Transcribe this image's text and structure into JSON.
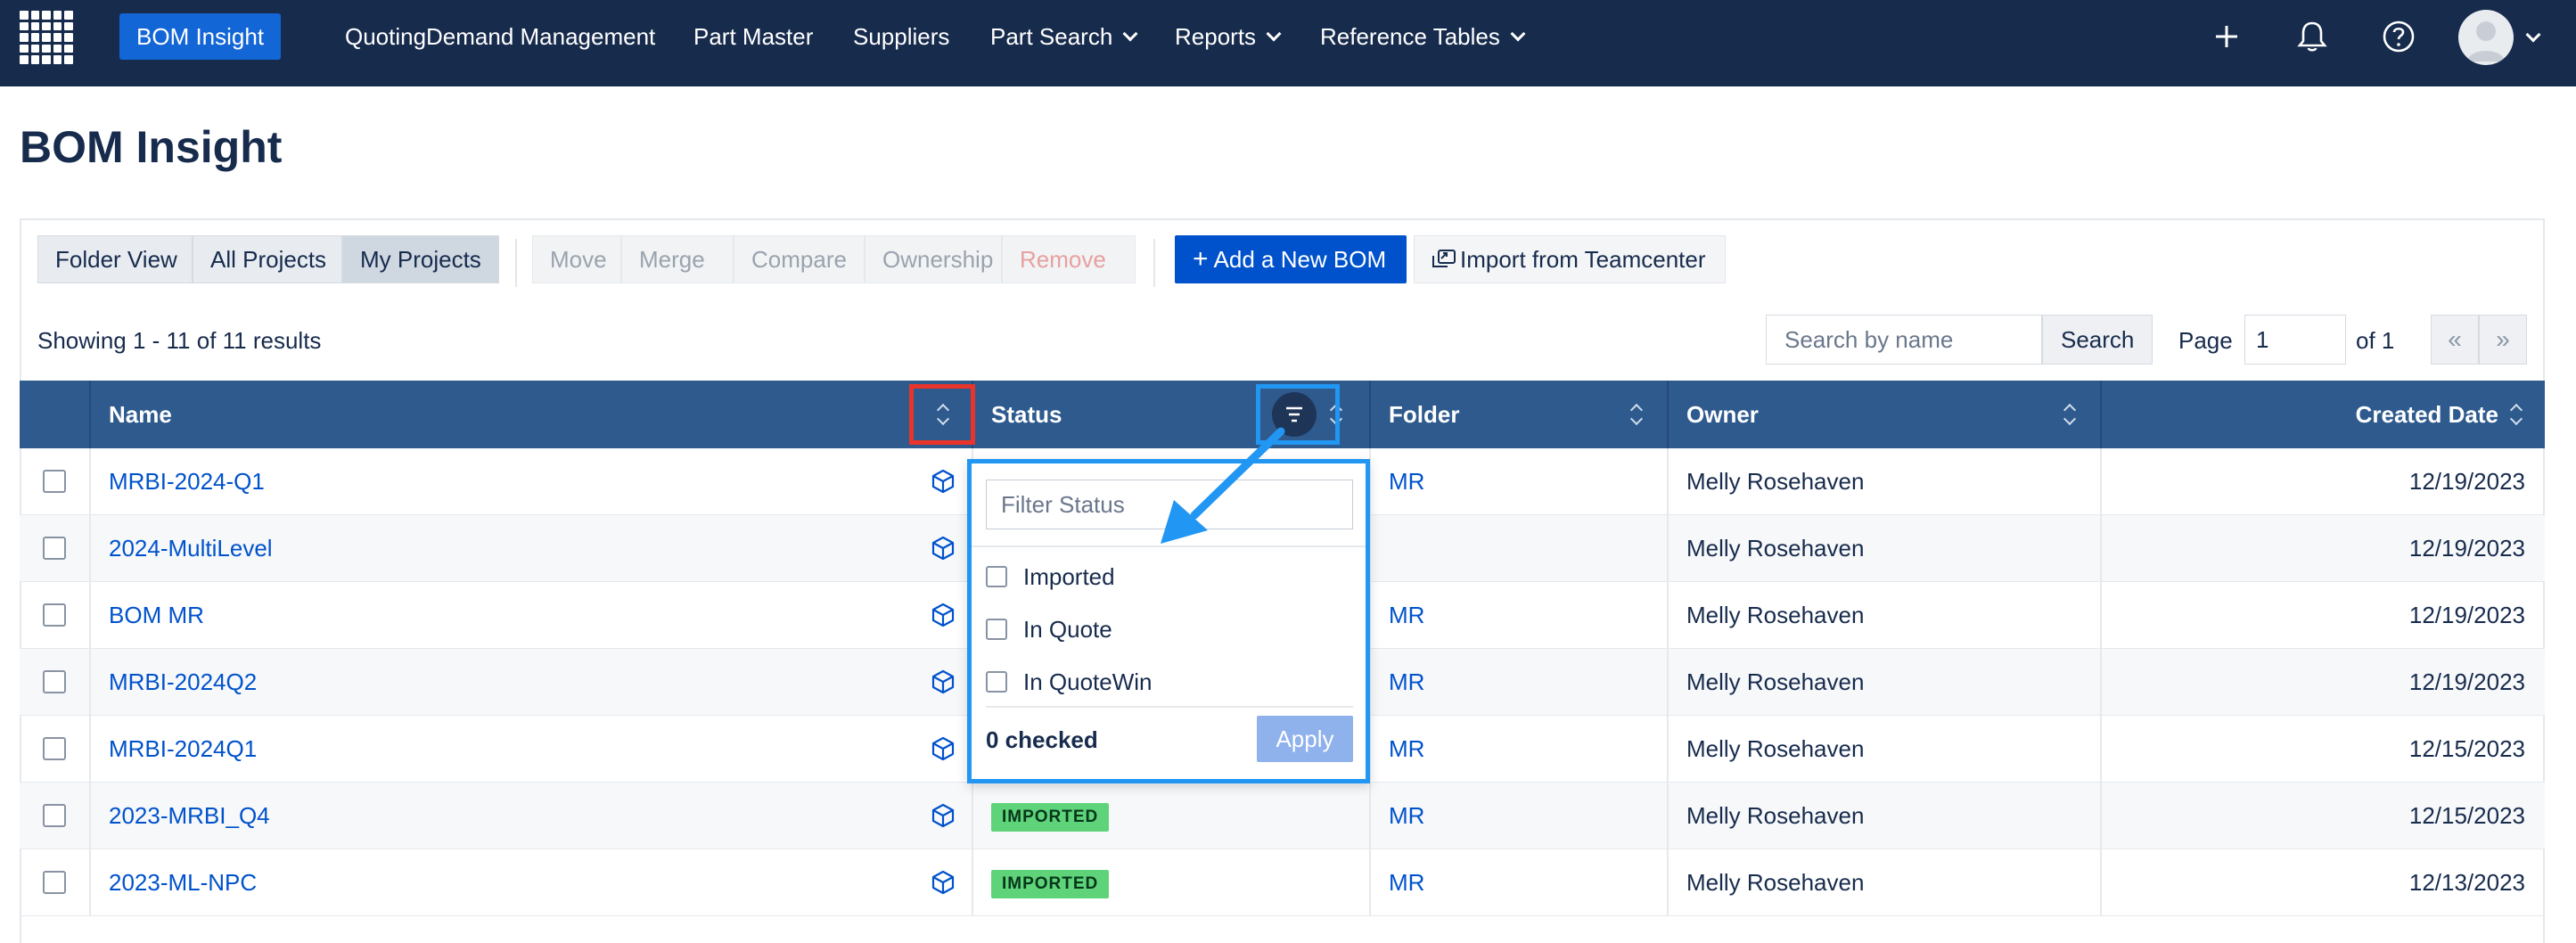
{
  "nav": {
    "items": [
      {
        "label": "BOM Insight",
        "active": true
      },
      {
        "label": "Quoting"
      },
      {
        "label": "Demand Management"
      },
      {
        "label": "Part Master"
      },
      {
        "label": "Suppliers"
      },
      {
        "label": "Part Search",
        "dropdown": true
      },
      {
        "label": "Reports",
        "dropdown": true
      },
      {
        "label": "Reference Tables",
        "dropdown": true
      }
    ],
    "icons": [
      "plus-icon",
      "bell-icon",
      "help-icon",
      "user-avatar"
    ]
  },
  "page": {
    "title": "BOM Insight"
  },
  "toolbar": {
    "views": [
      "Folder View",
      "All Projects",
      "My Projects"
    ],
    "selected_view": "My Projects",
    "actions": [
      "Move",
      "Merge",
      "Compare",
      "Ownership",
      "Remove"
    ],
    "add_label": "Add a New BOM",
    "import_label": "Import from Teamcenter"
  },
  "listing": {
    "results_text": "Showing 1 - 11 of 11 results",
    "search_placeholder": "Search by name",
    "search_label": "Search",
    "page_label": "Page",
    "page_value": "1",
    "of_label": "of 1",
    "prev": "«",
    "next": "»"
  },
  "table": {
    "columns": [
      "Name",
      "Status",
      "Folder",
      "Owner",
      "Created Date"
    ],
    "rows": [
      {
        "name": "MRBI-2024-Q1",
        "status": "",
        "folder": "MR",
        "owner": "Melly Rosehaven",
        "date": "12/19/2023"
      },
      {
        "name": "2024-MultiLevel",
        "status": "",
        "folder": "",
        "owner": "Melly Rosehaven",
        "date": "12/19/2023"
      },
      {
        "name": "BOM MR",
        "status": "",
        "folder": "MR",
        "owner": "Melly Rosehaven",
        "date": "12/19/2023"
      },
      {
        "name": "MRBI-2024Q2",
        "status": "",
        "folder": "MR",
        "owner": "Melly Rosehaven",
        "date": "12/19/2023"
      },
      {
        "name": "MRBI-2024Q1",
        "status": "",
        "folder": "MR",
        "owner": "Melly Rosehaven",
        "date": "12/15/2023"
      },
      {
        "name": "2023-MRBI_Q4",
        "status": "IMPORTED",
        "folder": "MR",
        "owner": "Melly Rosehaven",
        "date": "12/15/2023"
      },
      {
        "name": "2023-ML-NPC",
        "status": "IMPORTED",
        "folder": "MR",
        "owner": "Melly Rosehaven",
        "date": "12/13/2023"
      }
    ]
  },
  "filter_popup": {
    "placeholder": "Filter Status",
    "options": [
      "Imported",
      "In Quote",
      "In QuoteWin"
    ],
    "checked_text": "0 checked",
    "apply_label": "Apply"
  },
  "colors": {
    "nav_bg": "#172b4d",
    "accent": "#0052cc",
    "table_header": "#2e5a8e",
    "badge_green": "#5fd37a",
    "annotation_red": "#e8342a",
    "annotation_blue": "#2196f3"
  }
}
